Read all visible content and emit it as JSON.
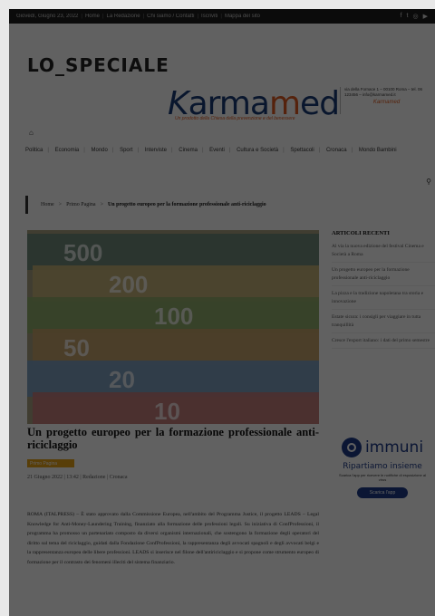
{
  "topbar": {
    "links": [
      "Giovedì, Giugno 23, 2022",
      "Home",
      "La Redazione",
      "Chi siamo / Contatti",
      "Iscriviti",
      "Mappa del sito"
    ],
    "social_icons": [
      "facebook-icon",
      "twitter-icon",
      "instagram-icon",
      "youtube-icon"
    ]
  },
  "site": {
    "logo": "LO_SPECIALE"
  },
  "banner": {
    "word_k": "K",
    "word_arma": "arma",
    "word_m": "m",
    "word_ed": "ed",
    "tagline": "Un prodotto della Chiesa della prevenzione e del benessere",
    "side_text": "via della Fornace 1 – 00100 Roma – tel. 06 123456 – info@karmamed.it",
    "side_signature": "Karmamed"
  },
  "nav": {
    "items": [
      "Politica",
      "Economia",
      "Mondo",
      "Sport",
      "Interviste",
      "Cinema",
      "Eventi",
      "Cultura e Società",
      "Spettacoli",
      "Cronaca",
      "Mondo Bambini"
    ]
  },
  "breadcrumb": {
    "home": "Home",
    "sep": ">",
    "section": "Primo Pagina",
    "current": "Un progetto europeo per la formazione professionale anti-riciclaggio"
  },
  "hero_image": {
    "banknotes": [
      "500",
      "200",
      "100",
      "50",
      "20",
      "10"
    ],
    "colors": [
      "#6a8a7a",
      "#c8b478",
      "#8fae6a",
      "#c8a26a",
      "#7aa0c8",
      "#c87a7a"
    ]
  },
  "article": {
    "title": "Un progetto europeo per la formazione professionale anti-riciclaggio",
    "category": "Primo Pagina",
    "meta": "21 Giugno 2022 | 13:42 | Redazione | Cronaca",
    "body": "ROMA (ITALPRESS) – È stato approvato dalla Commissione Europea, nell'ambito del Programma Justice, il progetto LEADS – Legal Knowledge for Anti-Money-Laundering Training, finanziato alla formazione delle professioni legali. Su iniziativa di ConfProfessioni, il programma ha promosso un partenariato composto da diversi organismi internazionali, che sostengono la formazione degli operatori del diritto sul tema del riciclaggio, guidati dalla Fondazione ConfProfessioni, la rappresentanza degli avvocati spagnoli e degli avvocati belgi e la rappresentanza europea delle libere professioni. LEADS si inserisce nel filone dell'antiriciclaggio e si propone come strumento europeo di formazione per il contrasto dei fenomeni illeciti del sistema finanziario."
  },
  "sidebar": {
    "title": "ARTICOLI RECENTI",
    "items": [
      "Al via la nuova edizione del festival Cinema e Società a Roma",
      "Un progetto europeo per la formazione professionale anti-riciclaggio",
      "La pizza e la tradizione napoletana tra storia e innovazione",
      "Estate sicura: i consigli per viaggiare in tutta tranquillità",
      "Cresce l'export italiano: i dati del primo semestre"
    ]
  },
  "ad": {
    "brand": "immuni",
    "slogan": "Ripartiamo insieme",
    "note": "Scarica l'app per ricevere le notifiche di esposizione al virus",
    "button": "Scarica l'app"
  }
}
